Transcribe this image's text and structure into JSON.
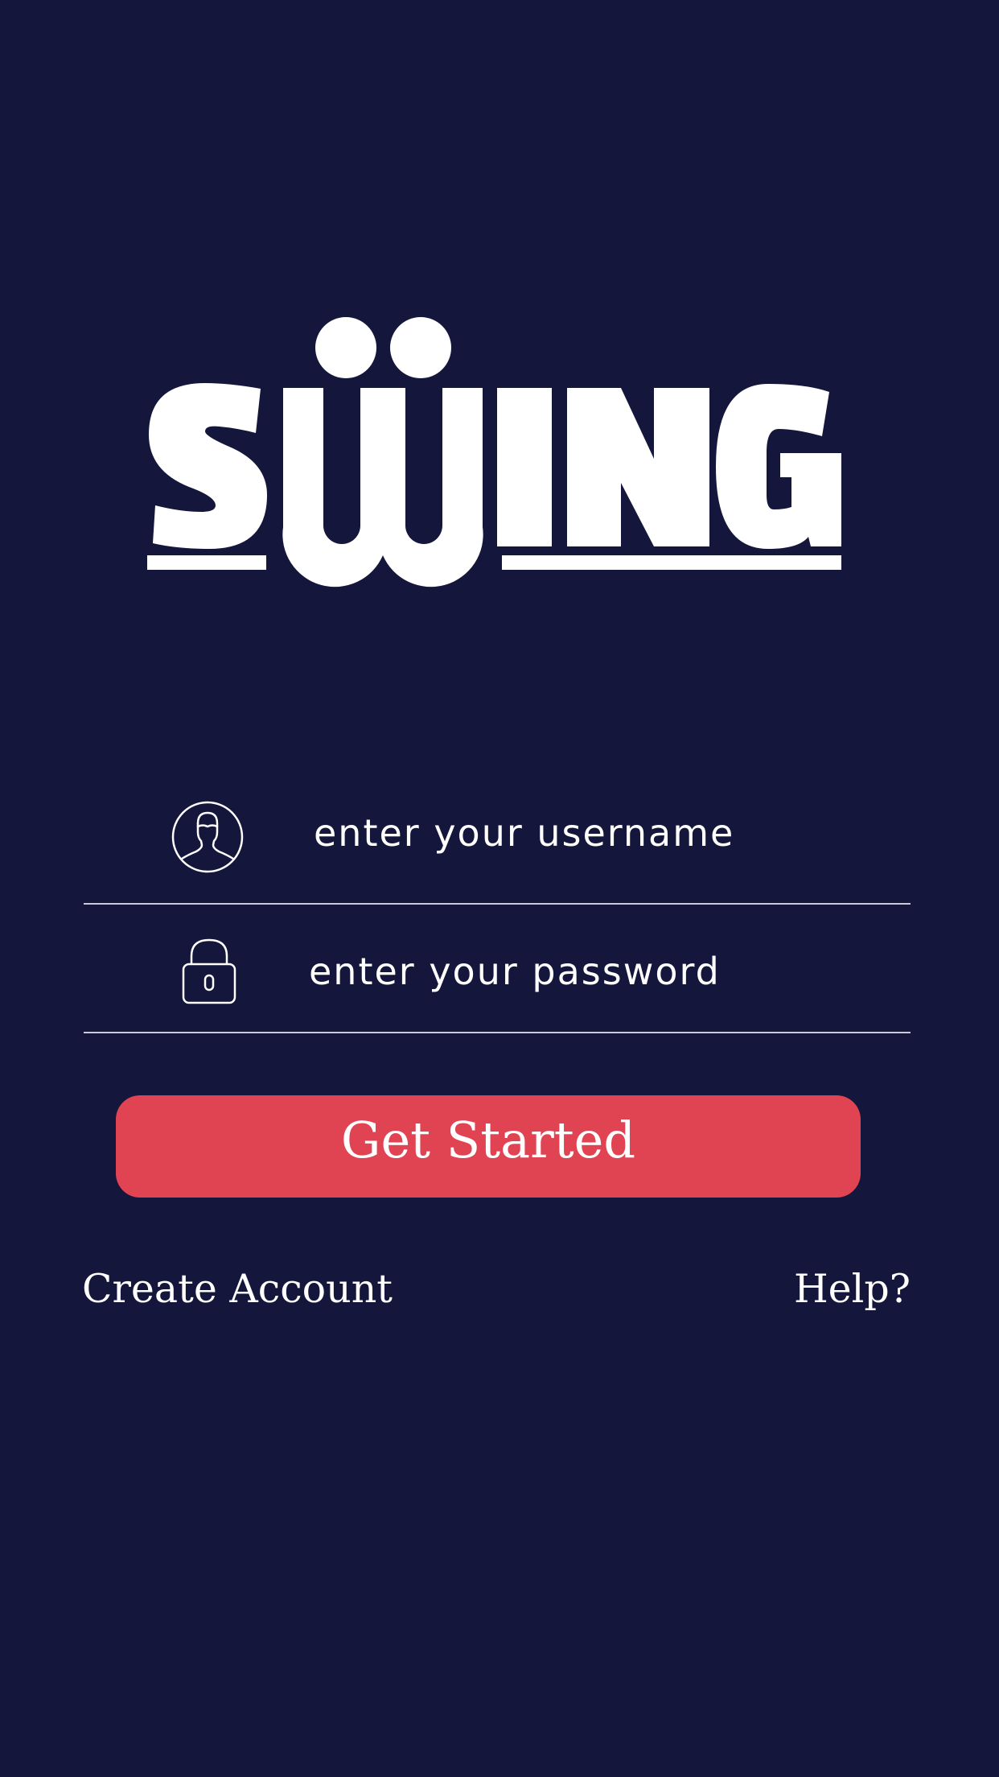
{
  "app": {
    "logo_text": "SWING",
    "background_color": "#14163b",
    "accent_color": "#e04453"
  },
  "login_form": {
    "username": {
      "icon": "user-profile-icon",
      "placeholder": "enter your username",
      "value": ""
    },
    "password": {
      "icon": "padlock-icon",
      "placeholder": "enter your password",
      "value": ""
    },
    "submit_label": "Get Started"
  },
  "links": {
    "create_account": "Create Account",
    "help": "Help?"
  }
}
